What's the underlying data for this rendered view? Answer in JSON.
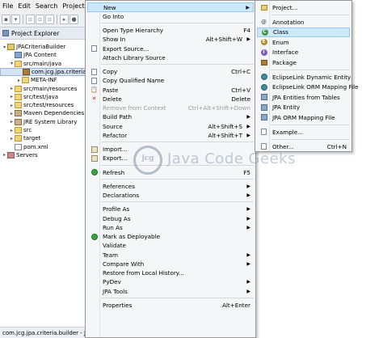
{
  "menubar": {
    "items": [
      "File",
      "Edit",
      "Search",
      "Project",
      "Ru"
    ]
  },
  "explorer": {
    "title": "Project Explorer",
    "tree": [
      {
        "label": "JPACriteriaBuilder",
        "indent": 1,
        "twisty": "▾",
        "icon": "project"
      },
      {
        "label": "JPA Content",
        "indent": 2,
        "twisty": "",
        "icon": "jpa"
      },
      {
        "label": "src/main/java",
        "indent": 2,
        "twisty": "▾",
        "icon": "folder"
      },
      {
        "label": "com.jcg.jpa.criteria",
        "indent": 3,
        "twisty": "",
        "icon": "pkg",
        "selected": true
      },
      {
        "label": "META-INF",
        "indent": 3,
        "twisty": "▸",
        "icon": "folder"
      },
      {
        "label": "src/main/resources",
        "indent": 2,
        "twisty": "▸",
        "icon": "folder"
      },
      {
        "label": "src/test/java",
        "indent": 2,
        "twisty": "▸",
        "icon": "folder"
      },
      {
        "label": "src/test/resources",
        "indent": 2,
        "twisty": "▸",
        "icon": "folder"
      },
      {
        "label": "Maven Dependencies",
        "indent": 2,
        "twisty": "▸",
        "icon": "lib"
      },
      {
        "label": "JRE System Library",
        "indent": 2,
        "twisty": "▸",
        "icon": "lib"
      },
      {
        "label": "src",
        "indent": 2,
        "twisty": "▸",
        "icon": "folder"
      },
      {
        "label": "target",
        "indent": 2,
        "twisty": "▸",
        "icon": "folder"
      },
      {
        "label": "pom.xml",
        "indent": 2,
        "twisty": "",
        "icon": "file"
      },
      {
        "label": "Servers",
        "indent": 1,
        "twisty": "▸",
        "icon": "servers"
      }
    ]
  },
  "statusbar": {
    "text": "com.jcg.jpa.criteria.builder - JP"
  },
  "context_menu": [
    {
      "label": "New",
      "arrow": true,
      "highlighted": true,
      "icon": ""
    },
    {
      "label": "Go Into",
      "icon": ""
    },
    {
      "sep": true
    },
    {
      "label": "Open Type Hierarchy",
      "shortcut": "F4",
      "icon": ""
    },
    {
      "label": "Show In",
      "shortcut": "Alt+Shift+W",
      "arrow": true,
      "icon": ""
    },
    {
      "label": "Export Source...",
      "icon": "page"
    },
    {
      "label": "Attach Library Source",
      "icon": ""
    },
    {
      "sep": true
    },
    {
      "label": "Copy",
      "shortcut": "Ctrl+C",
      "icon": "page"
    },
    {
      "label": "Copy Qualified Name",
      "icon": "page"
    },
    {
      "label": "Paste",
      "shortcut": "Ctrl+V",
      "icon": "clip"
    },
    {
      "label": "Delete",
      "shortcut": "Delete",
      "icon": "x"
    },
    {
      "label": "Remove from Context",
      "shortcut": "Ctrl+Alt+Shift+Down",
      "disabled": true,
      "icon": ""
    },
    {
      "label": "Build Path",
      "arrow": true,
      "icon": ""
    },
    {
      "label": "Source",
      "shortcut": "Alt+Shift+S",
      "arrow": true,
      "icon": ""
    },
    {
      "label": "Refactor",
      "shortcut": "Alt+Shift+T",
      "arrow": true,
      "icon": ""
    },
    {
      "sep": true
    },
    {
      "label": "Import...",
      "icon": "arrowbox"
    },
    {
      "label": "Export...",
      "icon": "arrowbox"
    },
    {
      "sep": true
    },
    {
      "label": "Refresh",
      "shortcut": "F5",
      "icon": "green"
    },
    {
      "sep": true
    },
    {
      "label": "References",
      "arrow": true,
      "icon": ""
    },
    {
      "label": "Declarations",
      "arrow": true,
      "icon": ""
    },
    {
      "sep": true
    },
    {
      "label": "Profile As",
      "arrow": true,
      "icon": ""
    },
    {
      "label": "Debug As",
      "arrow": true,
      "icon": ""
    },
    {
      "label": "Run As",
      "arrow": true,
      "icon": ""
    },
    {
      "label": "Mark as Deployable",
      "icon": "green"
    },
    {
      "label": "Validate",
      "icon": ""
    },
    {
      "label": "Team",
      "arrow": true,
      "icon": ""
    },
    {
      "label": "Compare With",
      "arrow": true,
      "icon": ""
    },
    {
      "label": "Restore from Local History...",
      "icon": ""
    },
    {
      "label": "PyDev",
      "arrow": true,
      "icon": ""
    },
    {
      "label": "JPA Tools",
      "arrow": true,
      "icon": ""
    },
    {
      "sep": true
    },
    {
      "label": "Properties",
      "shortcut": "Alt+Enter",
      "icon": ""
    }
  ],
  "submenu": [
    {
      "label": "Project...",
      "icon": "proj"
    },
    {
      "sep": true
    },
    {
      "label": "Annotation",
      "icon": "at"
    },
    {
      "label": "Class",
      "icon": "c",
      "highlighted": true
    },
    {
      "label": "Enum",
      "icon": "e"
    },
    {
      "label": "Interface",
      "icon": "i"
    },
    {
      "label": "Package",
      "icon": "pkg"
    },
    {
      "sep": true
    },
    {
      "label": "EclipseLink Dynamic Entity",
      "icon": "el"
    },
    {
      "label": "EclipseLink ORM Mapping File",
      "icon": "el"
    },
    {
      "label": "JPA Entities from Tables",
      "icon": "jpa"
    },
    {
      "label": "JPA Entity",
      "icon": "jpa"
    },
    {
      "label": "JPA ORM Mapping File",
      "icon": "jpa"
    },
    {
      "sep": true
    },
    {
      "label": "Example...",
      "icon": "page"
    },
    {
      "sep": true
    },
    {
      "label": "Other...",
      "shortcut": "Ctrl+N",
      "icon": "page"
    }
  ],
  "watermark": {
    "logo_text": "jcg",
    "text": "Java Code Geeks"
  }
}
